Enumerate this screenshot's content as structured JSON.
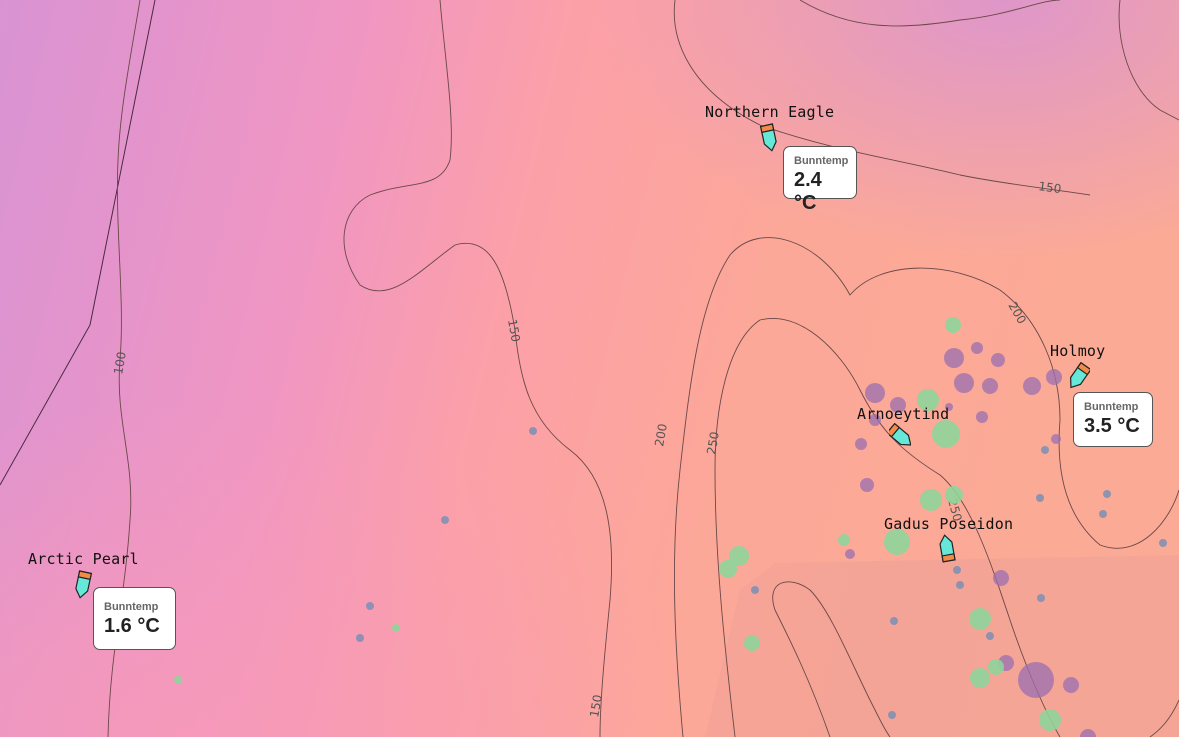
{
  "map": {
    "colors": {
      "cold": "#d993d3",
      "mid": "#f5a0b8",
      "warm": "#fca899",
      "contour": "#5a4040",
      "catch_purple": "#9b6fb0",
      "catch_green": "#8fd49a",
      "catch_blue": "#7a93b8"
    },
    "depth_labels": [
      {
        "text": "150",
        "id": "d150a"
      },
      {
        "text": "150",
        "id": "d150b"
      },
      {
        "text": "150",
        "id": "d150c"
      },
      {
        "text": "100",
        "id": "d100"
      },
      {
        "text": "200",
        "id": "d200a"
      },
      {
        "text": "200",
        "id": "d200b"
      },
      {
        "text": "250",
        "id": "d250a"
      },
      {
        "text": "250",
        "id": "d250b"
      }
    ]
  },
  "vessels": [
    {
      "name": "Northern Eagle",
      "temp_label": "Bunntemp",
      "temp_value": "2.4 °C"
    },
    {
      "name": "Holmoy",
      "temp_label": "Bunntemp",
      "temp_value": "3.5 °C"
    },
    {
      "name": "Arnoeytind"
    },
    {
      "name": "Gadus Poseidon"
    },
    {
      "name": "Arctic Pearl",
      "temp_label": "Bunntemp",
      "temp_value": "1.6 °C"
    }
  ],
  "icons": {
    "vessel": "vessel-icon"
  }
}
